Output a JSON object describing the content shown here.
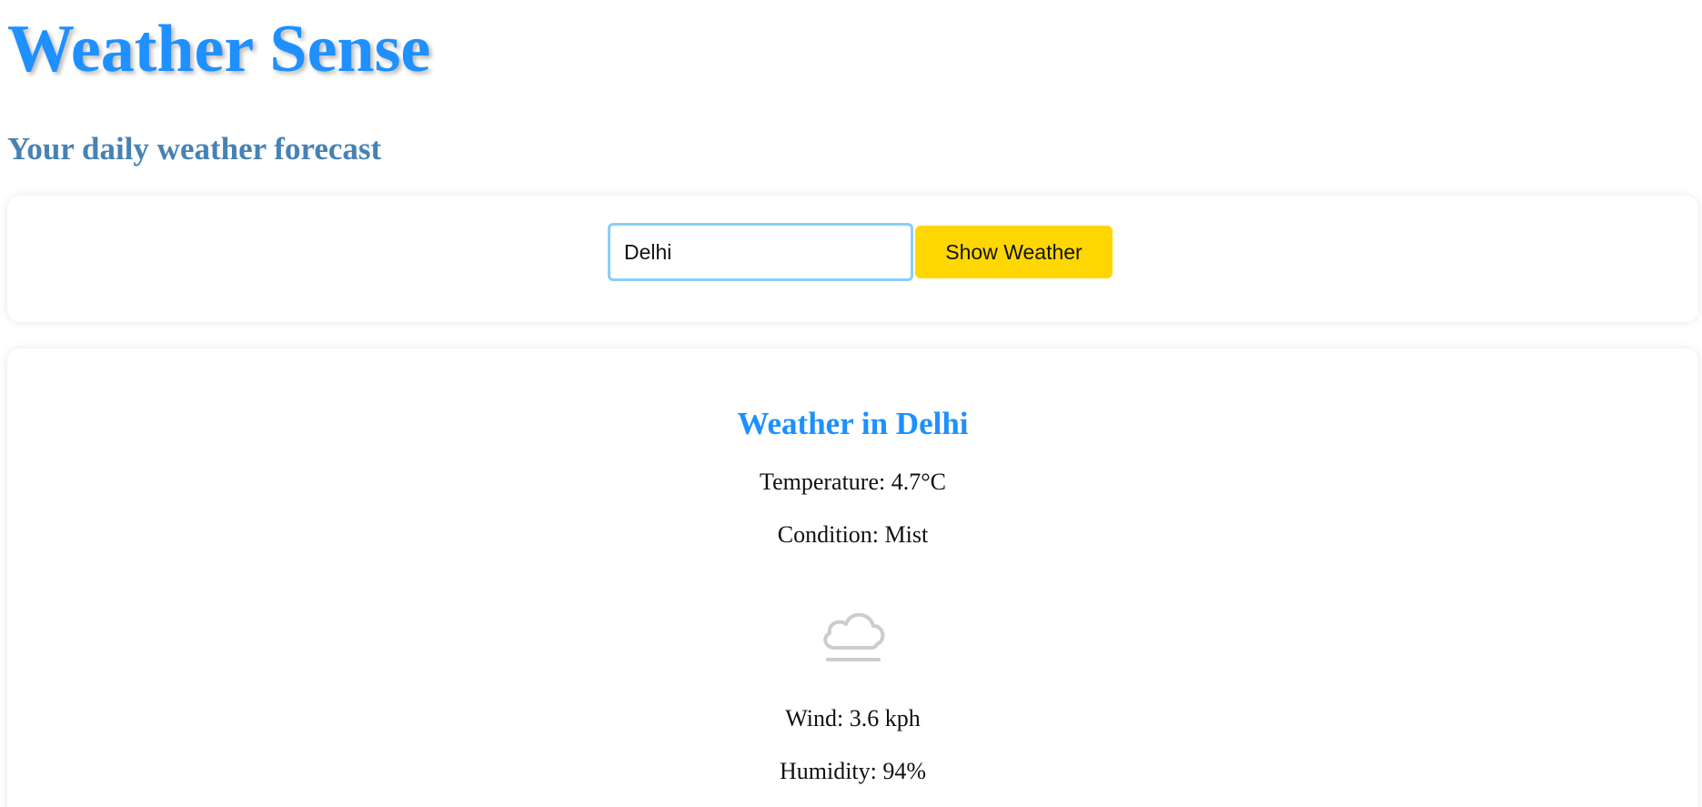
{
  "header": {
    "title": "Weather Sense",
    "subtitle": "Your daily weather forecast"
  },
  "search": {
    "city_value": "Delhi",
    "button_label": "Show Weather"
  },
  "result": {
    "title": "Weather in Delhi",
    "temperature": "Temperature: 4.7°C",
    "condition": "Condition: Mist",
    "condition_icon": "mist-icon",
    "wind": "Wind: 3.6 kph",
    "humidity": "Humidity: 94%"
  },
  "colors": {
    "title": "#1e90ff",
    "subtitle": "#4682b4",
    "button": "#ffd700",
    "input_border": "#87cefa"
  }
}
